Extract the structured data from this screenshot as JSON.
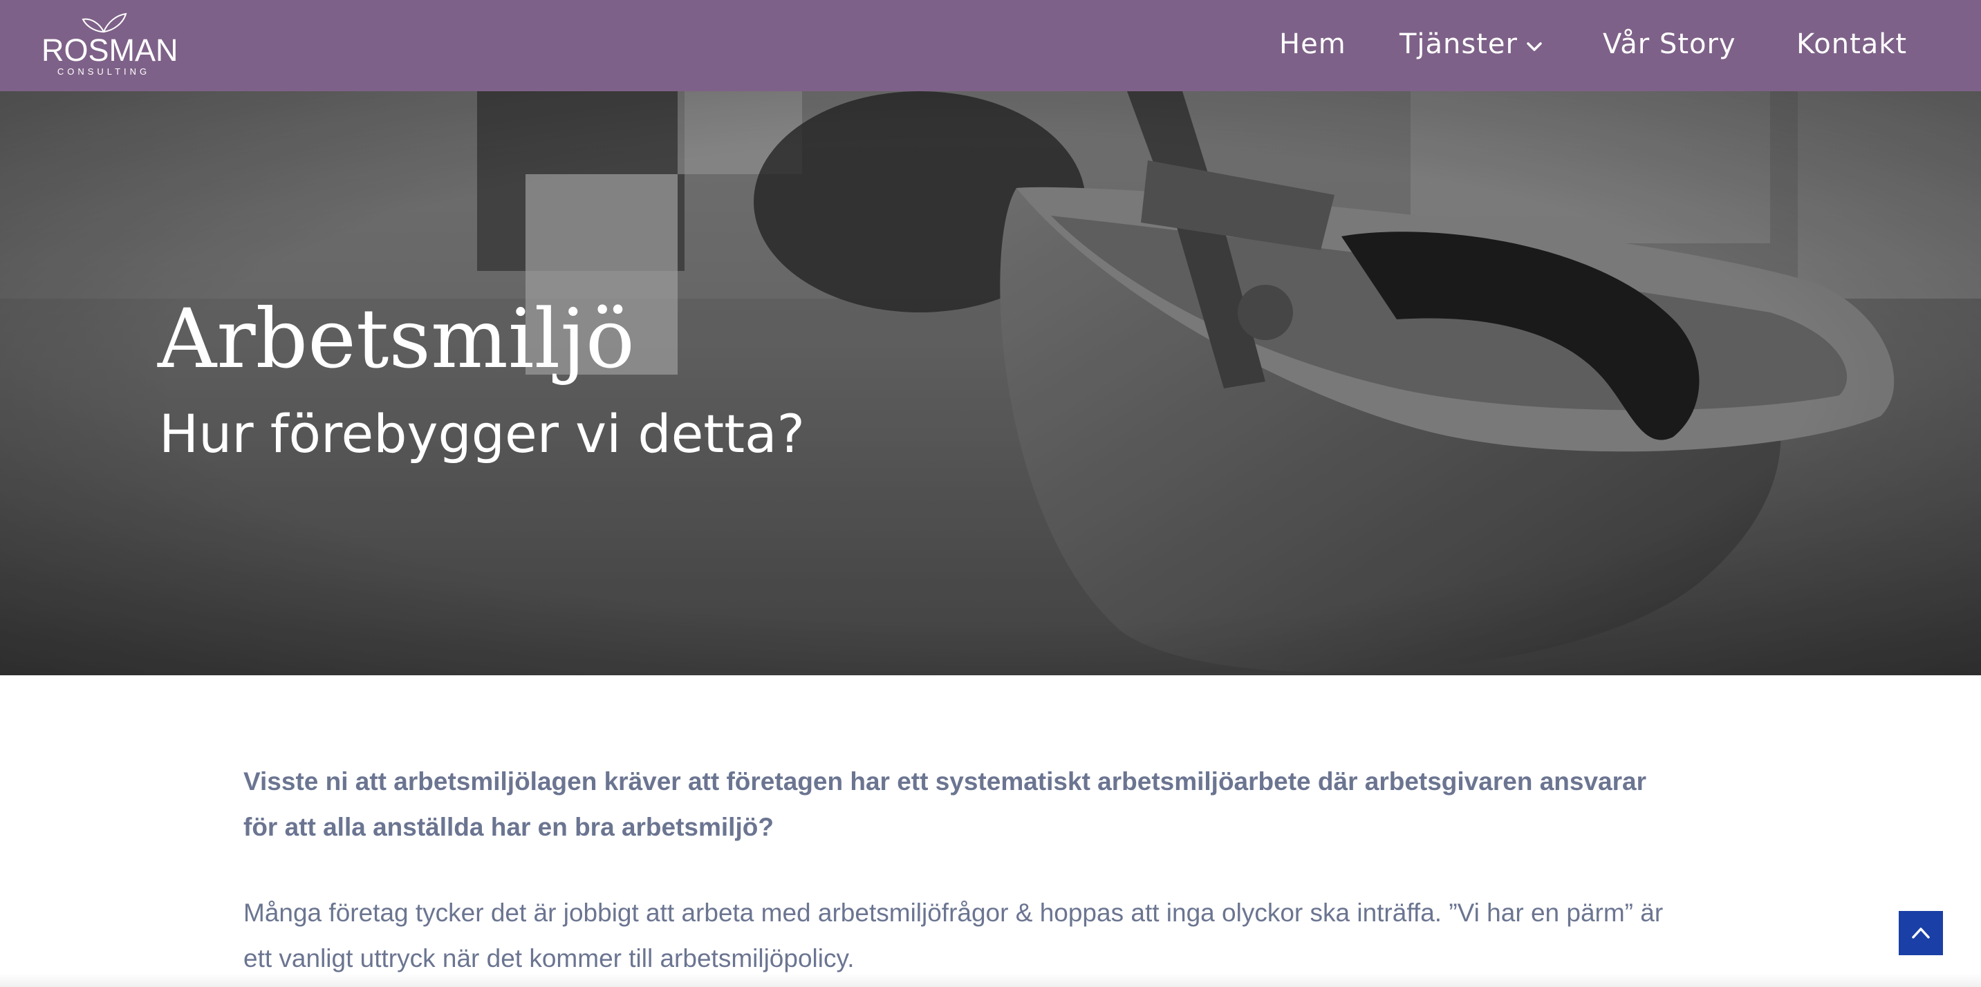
{
  "colors": {
    "nav_bg": "#7e6188",
    "text_muted": "#6b7591",
    "scroll_button": "#1a3fa6"
  },
  "header": {
    "logo": {
      "icon": "leaves-logo-icon",
      "word": "ROSMAN",
      "sub": "CONSULTING"
    },
    "nav": [
      {
        "label": "Hem"
      },
      {
        "label": "Tjänster",
        "icon": "chevron-down-icon"
      },
      {
        "label": "Vår Story"
      },
      {
        "label": "Kontakt"
      }
    ]
  },
  "hero": {
    "image": "hard-hat-photo",
    "title": "Arbetsmiljö",
    "subtitle": "Hur förebygger vi detta?"
  },
  "main": {
    "lead": "Visste ni att arbetsmiljölagen kräver att företagen har ett systematiskt arbetsmiljöarbete där arbetsgivaren ansvarar för att alla anställda har en bra arbetsmiljö?",
    "paragraph": "Många företag tycker det är jobbigt att arbeta med arbetsmiljöfrågor & hoppas att inga olyckor ska inträffa. ”Vi har en pärm” är ett vanligt uttryck när det kommer till arbetsmiljöpolicy."
  },
  "scroll_top": {
    "icon": "chevron-up-icon"
  }
}
